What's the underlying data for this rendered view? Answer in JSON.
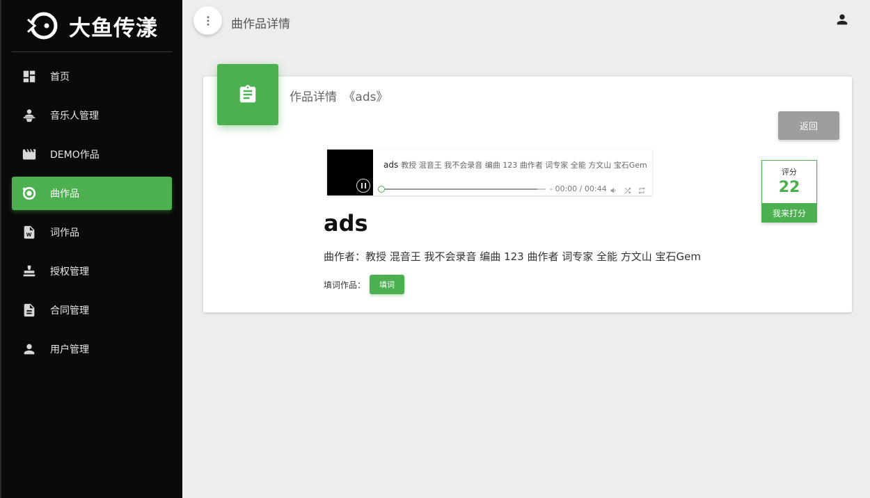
{
  "brand": {
    "name": "大鱼传漾"
  },
  "sidebar": {
    "items": [
      {
        "label": "首页",
        "icon": "dashboard-icon",
        "active": false
      },
      {
        "label": "音乐人管理",
        "icon": "musician-icon",
        "active": false
      },
      {
        "label": "DEMO作品",
        "icon": "clapperboard-icon",
        "active": false
      },
      {
        "label": "曲作品",
        "icon": "record-icon",
        "active": true
      },
      {
        "label": "词作品",
        "icon": "word-doc-icon",
        "active": false
      },
      {
        "label": "授权管理",
        "icon": "stamp-icon",
        "active": false
      },
      {
        "label": "合同管理",
        "icon": "document-icon",
        "active": false
      },
      {
        "label": "用户管理",
        "icon": "user-icon",
        "active": false
      }
    ]
  },
  "header": {
    "title": "曲作品详情"
  },
  "card": {
    "title": "作品详情",
    "work_name_quoted": "《ads》",
    "back_label": "返回"
  },
  "player": {
    "track_title": "ads",
    "track_artists": "教授 混音王 我不会录音 编曲 123 曲作者 词专家 全能 方文山 宝石Gem",
    "time": "- 00:00 / 00:44",
    "progress": 0
  },
  "score": {
    "label": "评分",
    "value": "22",
    "button_label": "我来打分"
  },
  "work": {
    "name": "ads",
    "composers": "曲作者：教授 混音王 我不会录音 编曲 123 曲作者 词专家 全能 方文山 宝石Gem",
    "lyric_label": "填词作品：",
    "lyric_button": "填词"
  },
  "colors": {
    "accent": "#4caf50",
    "sidebar_bg": "#0a0a0a",
    "page_bg": "#ededed",
    "back_button": "#9e9e9e"
  }
}
